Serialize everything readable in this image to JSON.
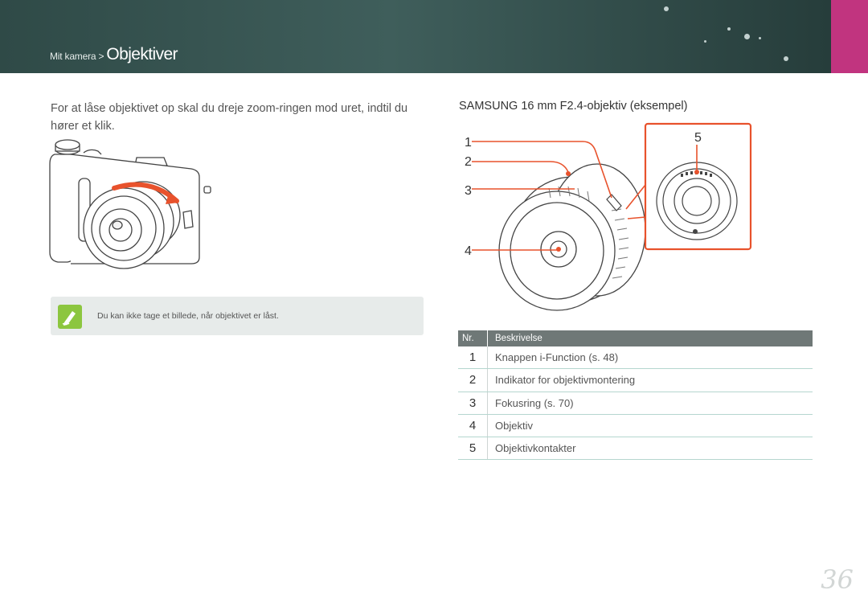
{
  "header": {
    "breadcrumb_parent": "Mit kamera > ",
    "breadcrumb_current": "Objektiver",
    "accent_color": "#c1347f"
  },
  "body_text": "For at låse objektivet op skal du dreje zoom-ringen mod uret, indtil du hører et klik.",
  "note": {
    "icon": "pencil-note-icon",
    "text": "Du kan ikke tage et billede, når objektivet er låst."
  },
  "lens_section": {
    "title": "SAMSUNG 16 mm F2.4-objektiv (eksempel)",
    "callouts": [
      "1",
      "2",
      "3",
      "4",
      "5"
    ]
  },
  "table": {
    "headers": [
      "Nr.",
      "Beskrivelse"
    ],
    "rows": [
      {
        "nr": "1",
        "desc": "Knappen i-Function (s. 48)"
      },
      {
        "nr": "2",
        "desc": "Indikator for objektivmontering"
      },
      {
        "nr": "3",
        "desc": "Fokusring (s. 70)"
      },
      {
        "nr": "4",
        "desc": "Objektiv"
      },
      {
        "nr": "5",
        "desc": "Objektivkontakter"
      }
    ]
  },
  "page_number": "36"
}
